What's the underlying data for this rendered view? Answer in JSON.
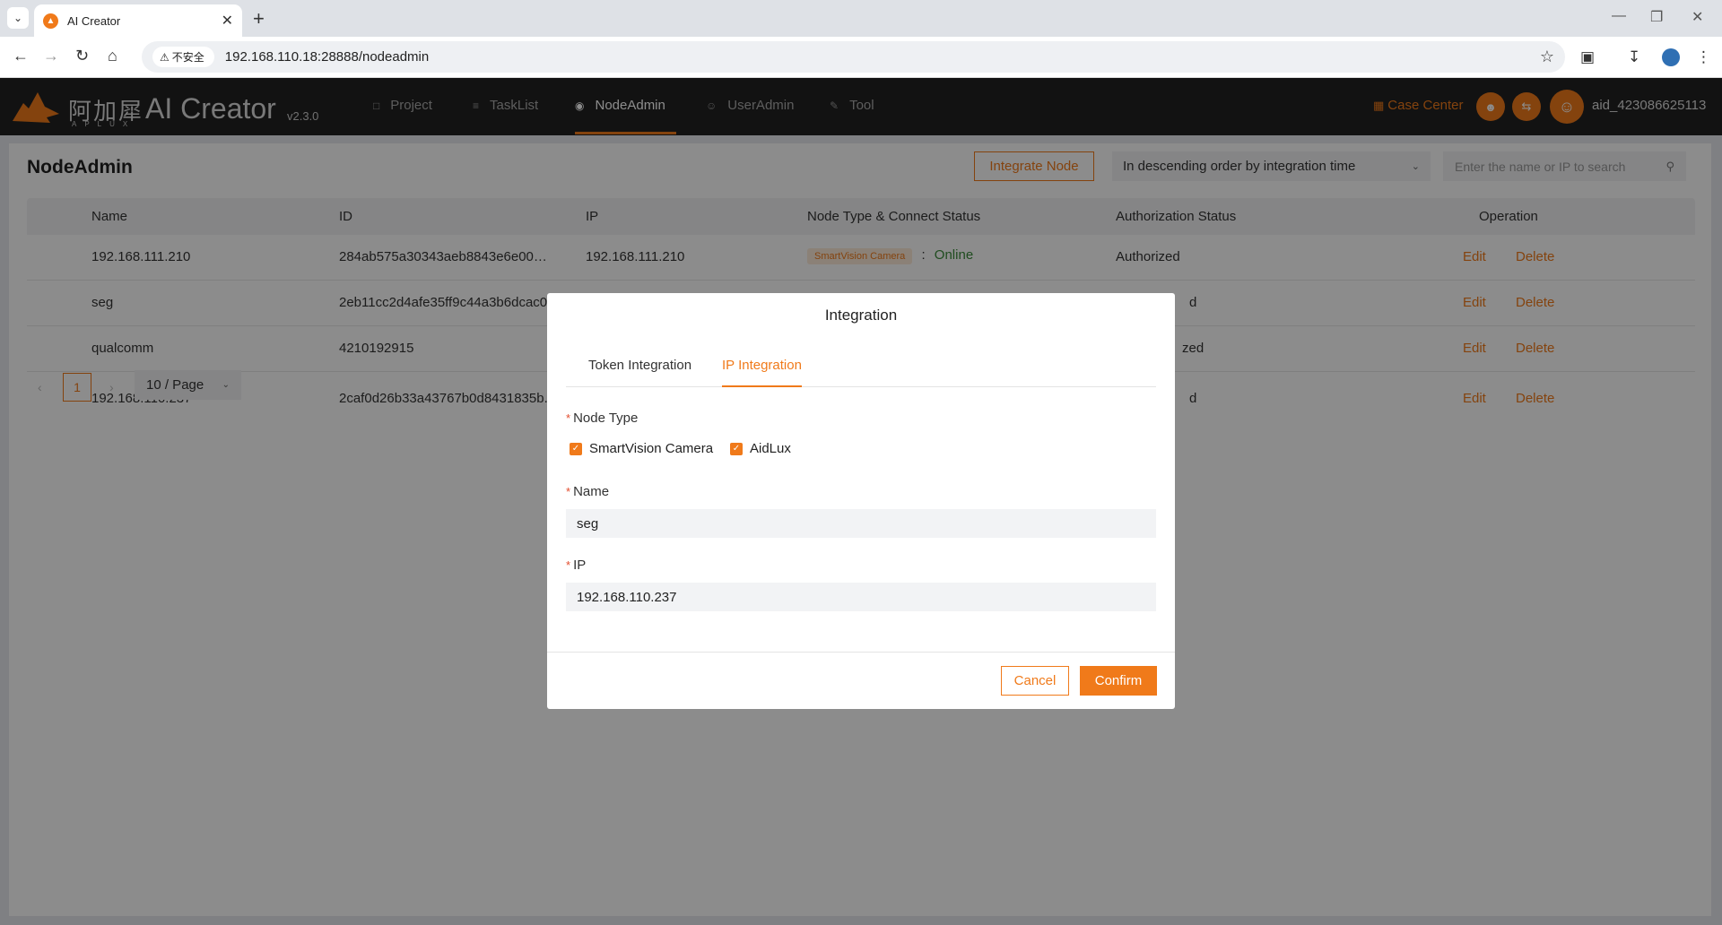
{
  "browser": {
    "tab_title": "AI Creator",
    "security_label": "不安全",
    "url": "192.168.110.18:28888/nodeadmin"
  },
  "app": {
    "logo_cn": "阿加犀",
    "logo_sub": "APLUX",
    "name": "AI Creator",
    "version": "v2.3.0",
    "accent": "#f07a1a"
  },
  "nav": {
    "items": [
      {
        "label": "Project",
        "icon": "folder-icon"
      },
      {
        "label": "TaskList",
        "icon": "list-icon"
      },
      {
        "label": "NodeAdmin",
        "icon": "node-icon"
      },
      {
        "label": "UserAdmin",
        "icon": "user-icon"
      },
      {
        "label": "Tool",
        "icon": "wrench-icon"
      }
    ],
    "active": "NodeAdmin",
    "case_center": "Case Center",
    "username": "aid_423086625113"
  },
  "page": {
    "title": "NodeAdmin",
    "integrate_button": "Integrate Node",
    "sort_value": "In descending order by integration time",
    "search_placeholder": "Enter the name or IP to search"
  },
  "table": {
    "columns": [
      "Name",
      "ID",
      "IP",
      "Node Type & Connect Status",
      "Authorization Status",
      "Operation"
    ],
    "rows": [
      {
        "name": "192.168.111.210",
        "id": "284ab575a30343aeb8843e6e0036...",
        "ip": "192.168.111.210",
        "type": "SmartVision Camera",
        "sep": ":",
        "status": "Online",
        "auth": "Authorized",
        "edit": "Edit",
        "delete": "Delete"
      },
      {
        "name": "seg",
        "id": "2eb11cc2d4afe35ff9c44a3b6dcac0",
        "ip": "",
        "type": "",
        "sep": "",
        "status": "",
        "auth": "d",
        "edit": "Edit",
        "delete": "Delete"
      },
      {
        "name": "qualcomm",
        "id": "4210192915",
        "ip": "",
        "type": "",
        "sep": "",
        "status": "",
        "auth": "zed",
        "edit": "Edit",
        "delete": "Delete"
      },
      {
        "name": "192.168.110.237",
        "id": "2caf0d26b33a43767b0d8431835b.",
        "ip": "",
        "type": "",
        "sep": "",
        "status": "",
        "auth": "d",
        "edit": "Edit",
        "delete": "Delete"
      }
    ]
  },
  "pager": {
    "current_page": "1",
    "page_size": "10 / Page"
  },
  "modal": {
    "title": "Integration",
    "tabs": [
      "Token Integration",
      "IP Integration"
    ],
    "active_tab": "IP Integration",
    "node_type_label": "Node Type",
    "node_types": [
      {
        "label": "SmartVision Camera",
        "checked": true
      },
      {
        "label": "AidLux",
        "checked": true
      }
    ],
    "name_label": "Name",
    "name_value": "seg",
    "ip_label": "IP",
    "ip_value": "192.168.110.237",
    "cancel": "Cancel",
    "confirm": "Confirm"
  }
}
